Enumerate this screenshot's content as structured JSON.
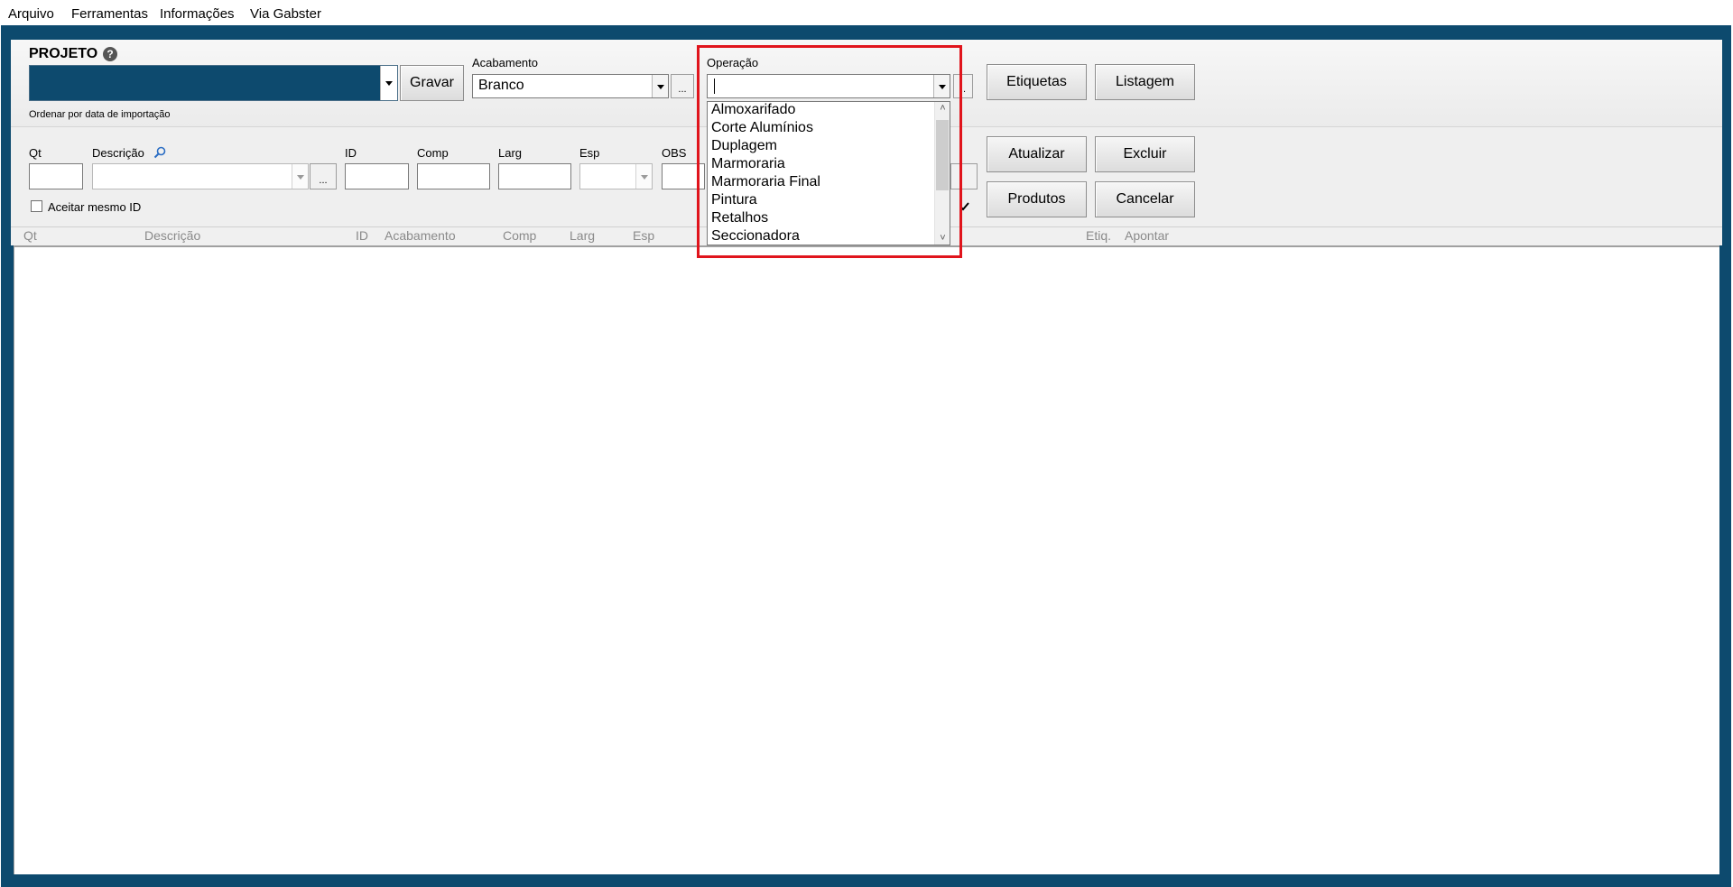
{
  "menu": [
    "Arquivo",
    "Ferramentas",
    "Informações",
    "Via Gabster"
  ],
  "projeto": {
    "label": "PROJETO",
    "save_label": "Gravar",
    "sort_hint": "Ordenar por data de importação"
  },
  "acabamento": {
    "label": "Acabamento",
    "value": "Branco",
    "more": "..."
  },
  "operacao": {
    "label": "Operação",
    "value": "",
    "more": "..",
    "options": [
      "Almoxarifado",
      "Corte Alumínios",
      "Duplagem",
      "Marmoraria",
      "Marmoraria Final",
      "Pintura",
      "Retalhos",
      "Seccionadora"
    ]
  },
  "buttons": {
    "etiquetas": "Etiquetas",
    "listagem": "Listagem",
    "atualizar": "Atualizar",
    "excluir": "Excluir",
    "produtos": "Produtos",
    "cancelar": "Cancelar"
  },
  "form": {
    "qt": "Qt",
    "descricao": "Descrição",
    "id": "ID",
    "comp": "Comp",
    "larg": "Larg",
    "esp": "Esp",
    "obs": "OBS",
    "more": "...",
    "aceitar_label": "Aceitar mesmo ID",
    "aceitar_checked": false
  },
  "grid_columns": [
    "Qt",
    "Descrição",
    "ID",
    "Acabamento",
    "Comp",
    "Larg",
    "Esp",
    "Etiq.",
    "Apontar"
  ],
  "colors": {
    "frame": "#0d4a6e",
    "highlight": "#e0141c"
  }
}
